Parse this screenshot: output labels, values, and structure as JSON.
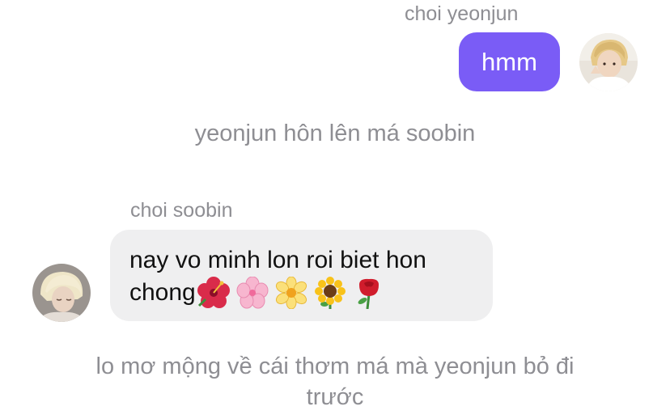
{
  "thread": {
    "outgoing": {
      "sender": "choi yeonjun",
      "text": "hmm"
    },
    "system_1": "yeonjun hôn lên má soobin",
    "incoming": {
      "sender": "choi soobin",
      "text_line1": "nay vo minh lon roi biet hon",
      "text_line2": "chong",
      "emojis": [
        "hibiscus",
        "cherry-blossom",
        "blossom",
        "sunflower",
        "rose"
      ]
    },
    "system_2": "lo mơ mộng về cái thơm má mà yeonjun bỏ đi trước"
  },
  "colors": {
    "outgoing_bubble": "#7a5cf6",
    "incoming_bubble": "#efeff0",
    "meta_text": "#8e8e93"
  }
}
